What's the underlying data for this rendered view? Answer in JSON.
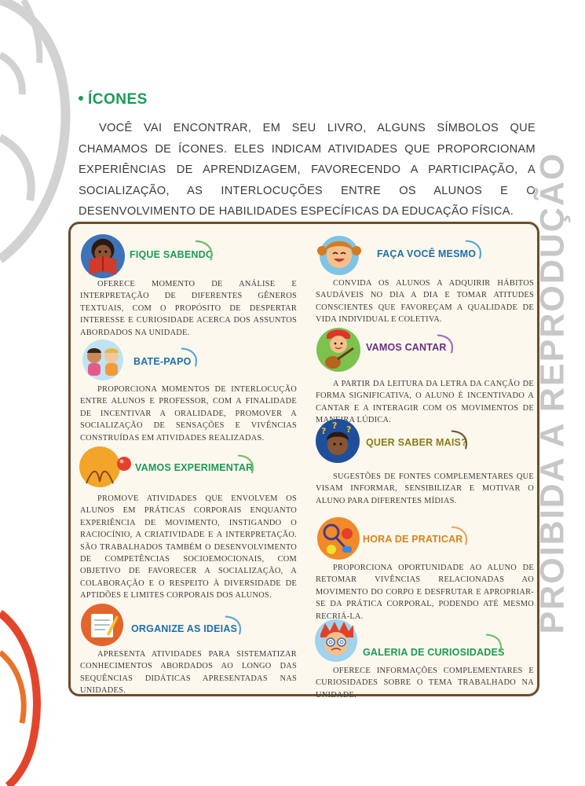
{
  "section": {
    "title": "ÍCONES",
    "intro": "VOCÊ VAI ENCONTRAR, EM SEU LIVRO, ALGUNS SÍMBOLOS QUE CHAMAMOS DE ÍCONES. ELES INDICAM ATIVIDADES QUE PROPORCIONAM EXPERIÊNCIAS DE APRENDIZAGEM, FAVORECENDO A PARTICIPAÇÃO, A SOCIALIZAÇÃO, AS INTERLOCUÇÕES ENTRE OS ALUNOS E O DESENVOLVIMENTO DE HABILIDADES ESPECÍFICAS DA EDUCAÇÃO FÍSICA."
  },
  "watermark": "PROIBIDA A REPRODUÇÃO",
  "colors": {
    "green": "#1a9a57",
    "blue": "#1f6fa8",
    "purple": "#6a2c82",
    "olive": "#8c7a12",
    "orange": "#d9831a",
    "card_border": "#6b4d2e",
    "card_bg": "#fcf8ee"
  },
  "icons": [
    {
      "title": "FIQUE SABENDO",
      "icon": "reading-child-icon",
      "description": "OFERECE MOMENTO DE ANÁLISE E INTERPRETAÇÃO DE DIFERENTES GÊNEROS TEXTUAIS, COM O PROPÓSITO DE DESPERTAR INTERESSE E CURIOSIDADE ACERCA DOS ASSUNTOS ABORDADOS NA UNIDADE."
    },
    {
      "title": "BATE-PAPO",
      "icon": "chatting-children-icon",
      "description": "PROPORCIONA MOMENTOS DE INTERLOCUÇÃO ENTRE ALUNOS E PROFESSOR, COM A FINALIDADE DE INCENTIVAR A ORALIDADE, PROMOVER A SOCIALIZAÇÃO DE SENSAÇÕES E VIVÊNCIAS CONSTRUÍDAS EM ATIVIDADES REALIZADAS."
    },
    {
      "title": "VAMOS EXPERIMENTAR",
      "icon": "bouncing-ball-icon",
      "description": "PROMOVE ATIVIDADES QUE ENVOLVEM OS ALUNOS EM PRÁTICAS CORPORAIS ENQUANTO EXPERIÊNCIA DE MOVIMENTO, INSTIGANDO O RACIOCÍNIO, A CRIATIVIDADE E A INTERPRETAÇÃO. SÃO TRABALHADOS TAMBÉM O DESENVOLVIMENTO DE COMPETÊNCIAS SOCIOEMOCIONAIS, COM OBJETIVO DE FAVORECER A SOCIALIZAÇÃO, A COLABORAÇÃO E O RESPEITO À DIVERSIDADE DE APTIDÕES E LIMITES CORPORAIS DOS ALUNOS."
    },
    {
      "title": "ORGANIZE AS IDEIAS",
      "icon": "notepad-pencil-icon",
      "description": "APRESENTA ATIVIDADES PARA SISTEMATIZAR CONHECIMENTOS ABORDADOS AO LONGO DAS SEQUÊNCIAS DIDÁTICAS APRESENTADAS NAS UNIDADES."
    },
    {
      "title": "FAÇA VOCÊ MESMO",
      "icon": "smiling-girl-icon",
      "description": "CONVIDA OS ALUNOS A ADQUIRIR HÁBITOS SAUDÁVEIS NO DIA A DIA E TOMAR ATITUDES CONSCIENTES QUE FAVOREÇAM A QUALIDADE DE VIDA INDIVIDUAL E COLETIVA."
    },
    {
      "title": "VAMOS CANTAR",
      "icon": "guitar-boy-icon",
      "description": "A PARTIR DA LEITURA DA LETRA DA CANÇÃO DE FORMA SIGNIFICATIVA, O ALUNO É INCENTIVADO A CANTAR E A INTERAGIR COM OS MOVIMENTOS DE MANEIRA LÚDICA."
    },
    {
      "title": "QUER SABER MAIS?",
      "icon": "question-child-icon",
      "description": "SUGESTÕES DE FONTES COMPLEMENTARES QUE VISAM INFORMAR, SENSIBILIZAR E MOTIVAR O ALUNO PARA DIFERENTES MÍDIAS."
    },
    {
      "title": "HORA DE PRATICAR",
      "icon": "sports-gear-icon",
      "description": "PROPORCIONA OPORTUNIDADE AO ALUNO DE RETOMAR VIVÊNCIAS RELACIONADAS AO MOVIMENTO DO CORPO E DESFRUTAR E APROPRIAR-SE DA PRÁTICA CORPORAL, PODENDO ATÉ MESMO RECRIÁ-LA."
    },
    {
      "title": "GALERIA DE CURIOSIDADES",
      "icon": "dizzy-boy-icon",
      "description": "OFERECE INFORMAÇÕES COMPLEMENTARES E CURIOSIDADES SOBRE O TEMA TRABALHADO NA UNIDADE."
    }
  ]
}
